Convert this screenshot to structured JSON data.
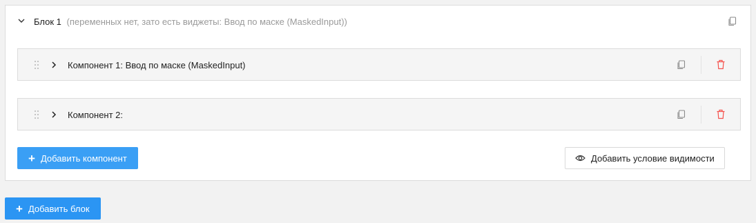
{
  "block": {
    "title": "Блок 1",
    "subtitle": "(переменных нет, зато есть виджеты: Ввод по маске (MaskedInput))",
    "components": [
      {
        "title": "Компонент 1: Ввод по маске (MaskedInput)"
      },
      {
        "title": "Компонент 2:"
      }
    ],
    "add_component_label": "Добавить компонент",
    "add_visibility_label": "Добавить условие видимости"
  },
  "add_block_label": "Добавить блок",
  "colors": {
    "primary": "#3a9ff5",
    "danger": "#f5504b",
    "muted": "#9a9a9a"
  },
  "icons": [
    "chevron-down-icon",
    "chevron-right-icon",
    "drag-handle-icon",
    "copy-icon",
    "trash-icon",
    "eye-icon",
    "plus-icon"
  ]
}
